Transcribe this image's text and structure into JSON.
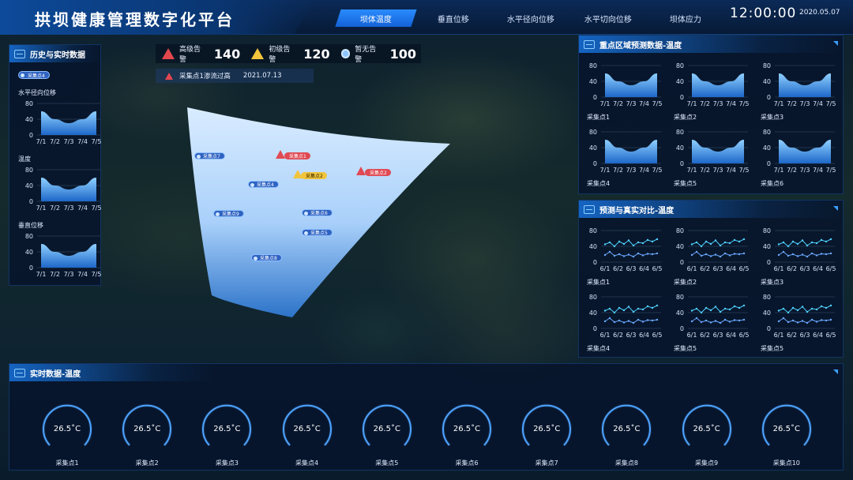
{
  "title": "拱坝健康管理数字化平台",
  "tabs": [
    {
      "label": "坝体温度",
      "active": true
    },
    {
      "label": "垂直位移",
      "active": false
    },
    {
      "label": "水平径向位移",
      "active": false
    },
    {
      "label": "水平切向位移",
      "active": false
    },
    {
      "label": "坝体应力",
      "active": false
    }
  ],
  "clock": "12:00:00",
  "date": "2020.05.07",
  "left_panel": {
    "title": "历史与实时数据",
    "badge": "采集点4",
    "charts": [
      {
        "label": "水平径向位移"
      },
      {
        "label": "温度"
      },
      {
        "label": "垂直位移"
      }
    ]
  },
  "alerts": [
    {
      "label": "高级告警",
      "count": "140",
      "color": "#e2474d"
    },
    {
      "label": "初级告警",
      "count": "120",
      "color": "#f1c43b"
    },
    {
      "label": "暂无告警",
      "count": "100",
      "color": "#8cc6ff"
    }
  ],
  "notice": {
    "text": "采集点1渗流过高",
    "date": "2021.07.13"
  },
  "markers": [
    {
      "label": "采集点7",
      "kind": "blue"
    },
    {
      "label": "采集点1",
      "kind": "red"
    },
    {
      "label": "采集点2",
      "kind": "yel"
    },
    {
      "label": "采集点2",
      "kind": "red"
    },
    {
      "label": "采集点4",
      "kind": "blue"
    },
    {
      "label": "采集点9",
      "kind": "blue"
    },
    {
      "label": "采集点6",
      "kind": "blue"
    },
    {
      "label": "采集点5",
      "kind": "blue"
    },
    {
      "label": "采集点8",
      "kind": "blue"
    }
  ],
  "forecast_panel": {
    "title": "重点区域预测数据-温度",
    "items": [
      "采集点1",
      "采集点2",
      "采集点3",
      "采集点4",
      "采集点5",
      "采集点6"
    ]
  },
  "compare_panel": {
    "title": "预测与真实对比-温度",
    "items": [
      "采集点1",
      "采集点2",
      "采集点3",
      "采集点4",
      "采集点5",
      "采集点5"
    ]
  },
  "bottom_panel": {
    "title": "实时数据-温度",
    "gauges": [
      {
        "value": "26.5˚C",
        "label": "采集点1"
      },
      {
        "value": "26.5˚C",
        "label": "采集点2"
      },
      {
        "value": "26.5˚C",
        "label": "采集点3"
      },
      {
        "value": "26.5˚C",
        "label": "采集点4"
      },
      {
        "value": "26.5˚C",
        "label": "采集点5"
      },
      {
        "value": "26.5˚C",
        "label": "采集点6"
      },
      {
        "value": "26.5˚C",
        "label": "采集点7"
      },
      {
        "value": "26.5˚C",
        "label": "采集点8"
      },
      {
        "value": "26.5˚C",
        "label": "采集点9"
      },
      {
        "value": "26.5˚C",
        "label": "采集点10"
      }
    ]
  },
  "chart_data": [
    {
      "type": "area",
      "name": "mini-area",
      "x": [
        "7/1",
        "7/2",
        "7/3",
        "7/4",
        "7/5"
      ],
      "values": [
        60,
        40,
        30,
        40,
        60
      ],
      "ylim": [
        0,
        80
      ],
      "yticks": [
        "80",
        "40",
        "0"
      ]
    },
    {
      "type": "line",
      "name": "mini-compare",
      "x": [
        "6/1",
        "6/2",
        "6/3",
        "6/4",
        "6/5"
      ],
      "yticks": [
        "80",
        "40",
        "0"
      ],
      "ylim": [
        0,
        80
      ],
      "series": [
        {
          "values": [
            45,
            50,
            40,
            52,
            46,
            55,
            42,
            50,
            48,
            56,
            52,
            58
          ]
        },
        {
          "values": [
            18,
            26,
            16,
            20,
            15,
            19,
            14,
            22,
            17,
            21,
            20,
            22
          ]
        }
      ]
    }
  ],
  "colors": {
    "accent": "#2a8cff",
    "gauge": "#4ea3ff",
    "area_top": "#8fd0ff",
    "area_bottom": "#1d67c9"
  }
}
